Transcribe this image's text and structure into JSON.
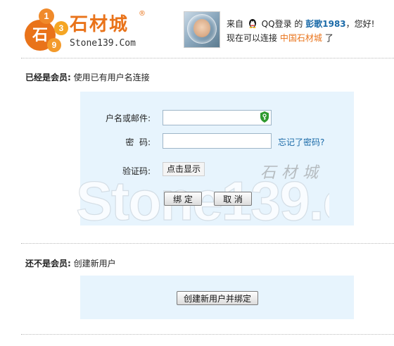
{
  "logo": {
    "circle_numbers": [
      "石",
      "1",
      "3",
      "9"
    ],
    "name_cn": "石材城",
    "registered_mark": "®",
    "name_en": "Stone139.Com",
    "brand_color": "#e9731a"
  },
  "header": {
    "welcome_prefix": "来自",
    "qq_icon": "qq-penguin-icon",
    "qq_label": "QQ登录",
    "welcome_de": "的",
    "nickname": "彭歌1983",
    "welcome_suffix": "，您好!",
    "line2_prefix": "现在可以连接",
    "site_link": "中国石材城",
    "line2_suffix": "了"
  },
  "member_section": {
    "title": "已经是会员:",
    "subtitle": "使用已有用户名连接",
    "username_label": "户名或邮件:",
    "username_value": "",
    "password_label": "密  码:",
    "password_value": "",
    "forgot_link": "忘记了密码?",
    "captcha_label": "验证码:",
    "captcha_button": "点击显示",
    "bind_button": "绑 定",
    "cancel_button": "取 消"
  },
  "watermark": {
    "text_en": "Stone139.com",
    "text_cn": "石材城"
  },
  "new_section": {
    "title": "还不是会员:",
    "subtitle": "创建新用户",
    "create_button": "创建新用户并绑定"
  },
  "colors": {
    "panel_bg": "#e7f4fd",
    "link": "#1a6aa8",
    "accent": "#e9731a"
  }
}
